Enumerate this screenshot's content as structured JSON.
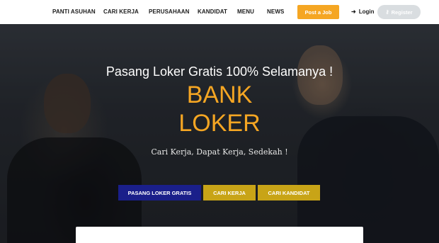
{
  "nav": {
    "items": [
      {
        "label": "PANTI ASUHAN"
      },
      {
        "label": "CARI KERJA"
      },
      {
        "label": "PERUSAHAAN"
      },
      {
        "label": "KANDIDAT"
      },
      {
        "label": "MENU"
      },
      {
        "label": "NEWS"
      }
    ],
    "post_job_label": "Post a Job",
    "login_label": "Login",
    "login_icon": "sign-in-icon",
    "register_label": "Register",
    "register_icon": "key-icon"
  },
  "hero": {
    "tagline": "Pasang Loker Gratis 100% Selamanya !",
    "brand_line1": "BANK",
    "brand_line2": "LOKER",
    "subtitle": "Cari Kerja, Dapat Kerja, Sedekah !",
    "buttons": {
      "primary": "PASANG LOKER GRATIS",
      "cari_kerja": "CARI KERJA",
      "cari_kandidat": "CARI KANDIDAT"
    }
  },
  "colors": {
    "accent_orange": "#f5a623",
    "button_blue": "#1a1f8a",
    "button_gold": "#c8a417",
    "register_gray": "#d9dde0"
  }
}
